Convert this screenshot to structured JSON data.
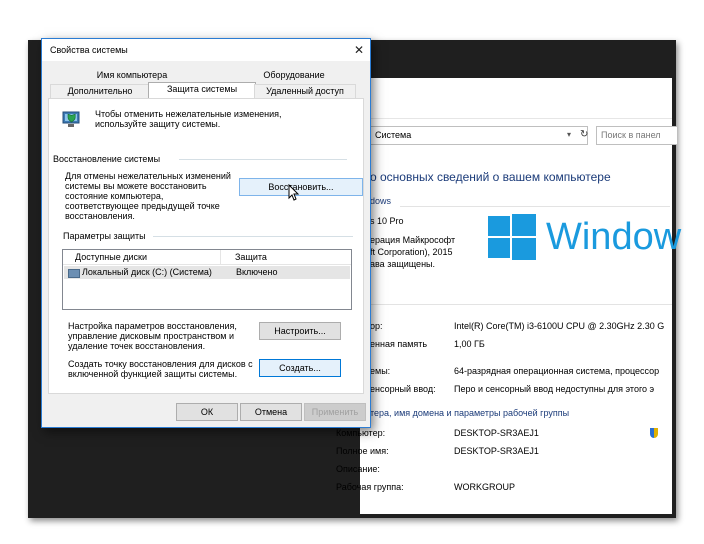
{
  "dialog": {
    "title": "Свойства системы",
    "close_glyph": "✕",
    "tabs_row1": [
      "Имя компьютера",
      "Оборудование"
    ],
    "tabs_row2": [
      "Дополнительно",
      "Защита системы",
      "Удаленный доступ"
    ],
    "active_tab": "Защита системы",
    "intro_text": "Чтобы отменить нежелательные изменения, используйте защиту системы.",
    "restore_group_title": "Восстановление системы",
    "restore_text": "Для отмены нежелательных изменений системы вы можете восстановить состояние компьютера, соответствующее предыдущей точке восстановления.",
    "restore_button": "Восстановить...",
    "protection_group_title": "Параметры защиты",
    "list_headers": [
      "Доступные диски",
      "Защита"
    ],
    "drives": [
      {
        "name": "Локальный диск (C:) (Система)",
        "status": "Включено"
      }
    ],
    "configure_text": "Настройка параметров восстановления, управление дисковым пространством и удаление точек восстановления.",
    "configure_button": "Настроить...",
    "create_text": "Создать точку восстановления для дисков с включенной функцией защиты системы.",
    "create_button": "Создать...",
    "ok_button": "ОК",
    "cancel_button": "Отмена",
    "apply_button": "Применить"
  },
  "background": {
    "breadcrumb": "Система",
    "breadcrumb_arrow": "›",
    "search_placeholder": "Поиск в панел",
    "heading": "о основных сведений о вашем компьютере",
    "edition_label": "dows",
    "edition_lines": [
      "s 10 Pro",
      "ерация Майкрософт",
      "ft Corporation), 2015",
      "ава защищены."
    ],
    "windows_wordmark": "Window",
    "system_rows": [
      {
        "label": "ор:",
        "value": "Intel(R) Core(TM) i3-6100U CPU @ 2.30GHz  2.30 G"
      },
      {
        "label": "енная память",
        "value": "1,00 ГБ"
      },
      {
        "label": "емы:",
        "value": "64-разрядная операционная система, процессор"
      },
      {
        "label": "енсорный ввод:",
        "value": "Перо и сенсорный ввод недоступны для этого э"
      }
    ],
    "section_label": "тера, имя домена и параметры рабочей группы",
    "network_rows": [
      {
        "label": "Компьютер:",
        "value": "DESKTOP-SR3AEJ1"
      },
      {
        "label": "Полное имя:",
        "value": "DESKTOP-SR3AEJ1"
      },
      {
        "label": "Описание:",
        "value": ""
      },
      {
        "label": "Рабочая группа:",
        "value": "WORKGROUP"
      }
    ]
  },
  "colors": {
    "accent": "#1a9ade",
    "link": "#1b3b79",
    "focus": "#0078d7"
  }
}
